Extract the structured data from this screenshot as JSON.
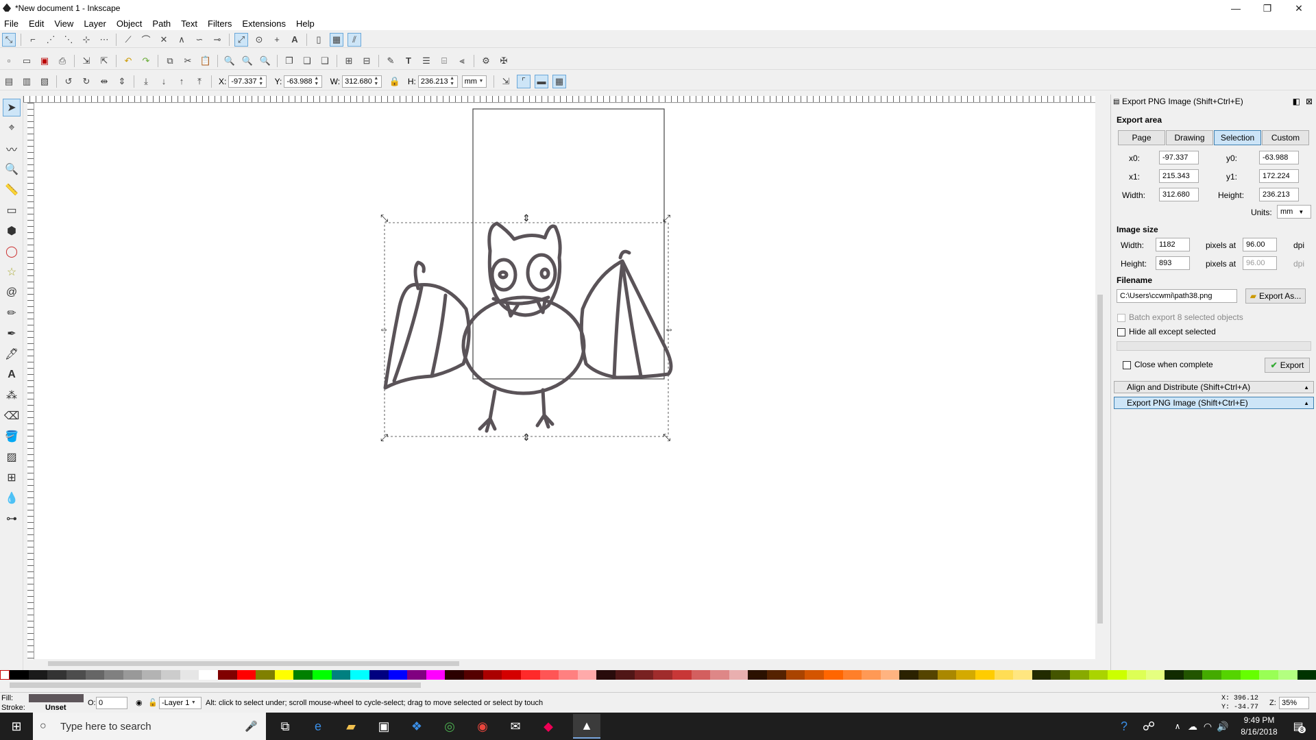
{
  "window": {
    "title": "*New document 1 - Inkscape",
    "minimize": "—",
    "restore": "❐",
    "close": "✕"
  },
  "menu": [
    "File",
    "Edit",
    "View",
    "Layer",
    "Object",
    "Path",
    "Text",
    "Filters",
    "Extensions",
    "Help"
  ],
  "toolbar3": {
    "x_label": "X:",
    "x_value": "-97.337",
    "y_label": "Y:",
    "y_value": "-63.988",
    "w_label": "W:",
    "w_value": "312.680",
    "h_label": "H:",
    "h_value": "236.213",
    "unit": "mm"
  },
  "export_panel": {
    "title": "Export PNG Image (Shift+Ctrl+E)",
    "export_area_heading": "Export area",
    "area_buttons": {
      "page": "Page",
      "drawing": "Drawing",
      "selection": "Selection",
      "custom": "Custom"
    },
    "selected_area": "Selection",
    "x0_label": "x0:",
    "x0": "-97.337",
    "y0_label": "y0:",
    "y0": "-63.988",
    "x1_label": "x1:",
    "x1": "215.343",
    "y1_label": "y1:",
    "y1": "172.224",
    "width_label": "Width:",
    "width": "312.680",
    "height_label": "Height:",
    "height": "236.213",
    "units_label": "Units:",
    "units": "mm",
    "image_size_heading": "Image size",
    "img_width_label": "Width:",
    "img_width": "1182",
    "img_height_label": "Height:",
    "img_height": "893",
    "pixels_at": "pixels at",
    "dpi_value": "96.00",
    "dpi_value2": "96.00",
    "dpi": "dpi",
    "filename_heading": "Filename",
    "filename": "C:\\Users\\ccwmi\\path38.png",
    "export_as": "Export As...",
    "batch_export": "Batch export 8 selected objects",
    "hide_all": "Hide all except selected",
    "close_when_complete": "Close when complete",
    "export_button": "Export",
    "align_distribute": "Align and Distribute (Shift+Ctrl+A)",
    "export_png_tab": "Export PNG Image (Shift+Ctrl+E)"
  },
  "statusbar": {
    "fill_label": "Fill:",
    "stroke_label": "Stroke:",
    "stroke_value": "Unset",
    "opacity_label": "O:",
    "opacity_value": "0",
    "layer": "-Layer 1",
    "message": "Alt: click to select under; scroll mouse-wheel to cycle-select; drag to move selected or select by touch",
    "cursor_x": "X:  396.12",
    "cursor_y": "Y:  -34.77",
    "zoom_label": "Z:",
    "zoom": "35%"
  },
  "taskbar": {
    "search_placeholder": "Type here to search",
    "time": "9:49 PM",
    "date": "8/16/2018",
    "notif_count": "8"
  },
  "colors": {
    "drawing_stroke": "#5a5358",
    "selection_blue": "#cce4f7",
    "fill_swatch": "#5e565b"
  }
}
